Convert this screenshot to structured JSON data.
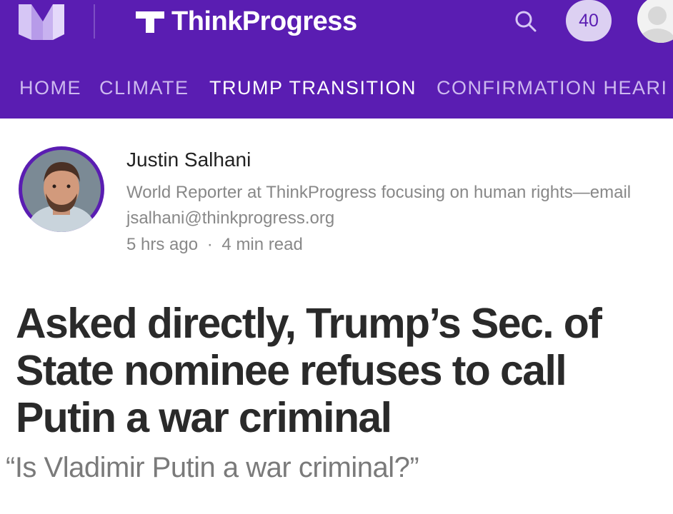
{
  "header": {
    "brand": "ThinkProgress",
    "notification_count": "40",
    "icons": {
      "medium_logo": "medium-m-logo",
      "brand_mark": "thinkprogress-t-logo",
      "search": "search-icon",
      "user": "user-avatar"
    },
    "colors": {
      "bar": "#5a1db2",
      "nav_inactive": "#cdb9ef",
      "nav_active": "#ffffff",
      "badge_bg": "#dcd0f2"
    }
  },
  "nav": {
    "items": [
      {
        "label": "HOME",
        "active": false
      },
      {
        "label": "CLIMATE",
        "active": false
      },
      {
        "label": "TRUMP TRANSITION",
        "active": true
      },
      {
        "label": "CONFIRMATION HEARI",
        "active": false
      }
    ]
  },
  "author": {
    "name": "Justin Salhani",
    "bio": "World Reporter at ThinkProgress focusing on human rights—email jsalhani@thinkprogress.org",
    "time": "5 hrs ago",
    "separator": "·",
    "read_time": "4 min read"
  },
  "article": {
    "headline": "Asked directly, Trump’s Sec. of State nominee refuses to call Putin a war criminal",
    "subtitle": "“Is Vladimir Putin a war criminal?”"
  }
}
